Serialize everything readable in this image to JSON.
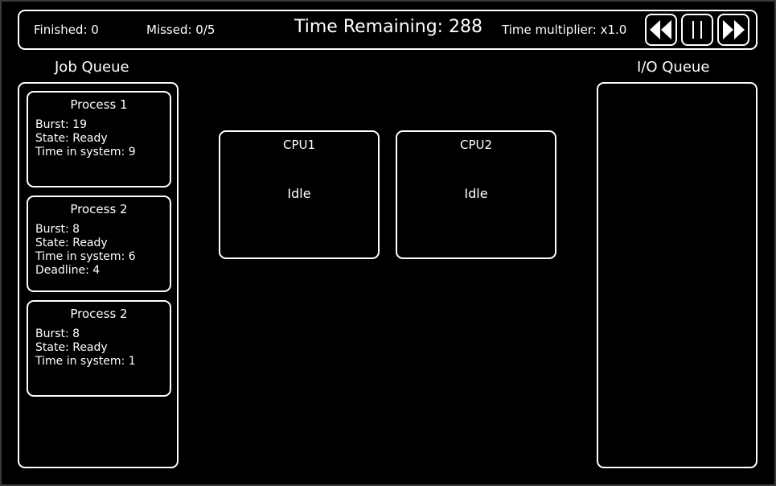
{
  "topbar": {
    "finished": "Finished: 0",
    "missed": "Missed: 0/5",
    "time_remaining": "Time Remaining: 288",
    "multiplier": "Time multiplier: x1.0",
    "controls": {
      "rewind_icon": "rewind-icon",
      "pause_icon": "pause-icon",
      "forward_icon": "fast-forward-icon"
    }
  },
  "job_queue": {
    "title": "Job Queue",
    "processes": [
      {
        "name": "Process 1",
        "burst": "Burst: 19",
        "state": "State: Ready",
        "time_in_system": "Time in system: 9"
      },
      {
        "name": "Process 2",
        "burst": "Burst: 8",
        "state": "State: Ready",
        "time_in_system": "Time in system: 6",
        "deadline": "Deadline: 4"
      },
      {
        "name": "Process 2",
        "burst": "Burst: 8",
        "state": "State: Ready",
        "time_in_system": "Time in system: 1"
      }
    ]
  },
  "cpus": [
    {
      "name": "CPU1",
      "status": "Idle"
    },
    {
      "name": "CPU2",
      "status": "Idle"
    }
  ],
  "io_queue": {
    "title": "I/O Queue"
  },
  "colors": {
    "background": "#000000",
    "foreground": "#ffffff"
  }
}
